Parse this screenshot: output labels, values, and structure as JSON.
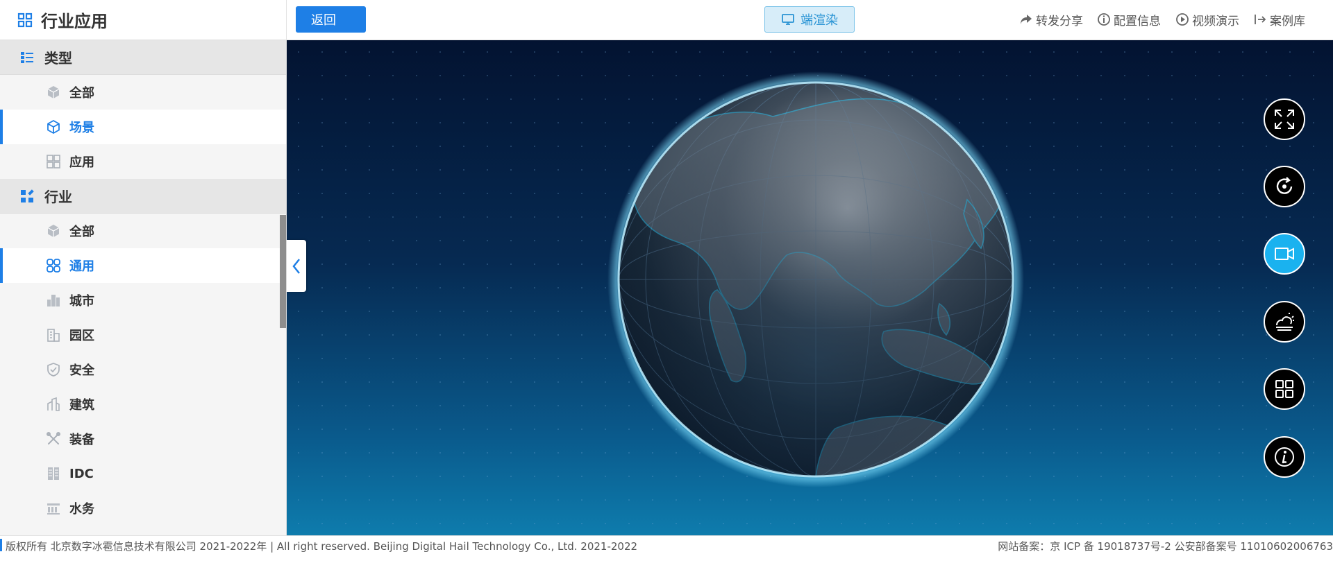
{
  "sidebar": {
    "title": "行业应用",
    "groups": [
      {
        "label": "类型",
        "items": [
          {
            "label": "全部"
          },
          {
            "label": "场景"
          },
          {
            "label": "应用"
          }
        ]
      },
      {
        "label": "行业",
        "items": [
          {
            "label": "全部"
          },
          {
            "label": "通用"
          },
          {
            "label": "城市"
          },
          {
            "label": "园区"
          },
          {
            "label": "安全"
          },
          {
            "label": "建筑"
          },
          {
            "label": "装备"
          },
          {
            "label": "IDC"
          },
          {
            "label": "水务"
          }
        ]
      }
    ]
  },
  "toolbar": {
    "back_label": "返回",
    "render_label": "端渲染",
    "links": [
      {
        "label": "转发分享",
        "icon": "share-icon"
      },
      {
        "label": "配置信息",
        "icon": "info-icon"
      },
      {
        "label": "视频演示",
        "icon": "play-icon"
      },
      {
        "label": "案例库",
        "icon": "library-icon"
      }
    ]
  },
  "viewport_tools": [
    {
      "name": "fullscreen",
      "icon": "expand-icon"
    },
    {
      "name": "rotate",
      "icon": "rotate-icon"
    },
    {
      "name": "record",
      "icon": "video-camera-icon",
      "active": true
    },
    {
      "name": "weather",
      "icon": "weather-icon"
    },
    {
      "name": "grid",
      "icon": "grid-icon"
    },
    {
      "name": "info",
      "icon": "info-icon"
    }
  ],
  "footer": {
    "copyright": "版权所有 北京数字冰雹信息技术有限公司 2021-2022年 | All right reserved. Beijing Digital Hail Technology Co., Ltd. 2021-2022",
    "record": "网站备案：京 ICP 备 19018737号-2 公安部备案号 11010602006763"
  },
  "colors": {
    "accent": "#1e7fe6",
    "tool_active": "#1ab2ef",
    "globe_outline": "#26c6f2"
  }
}
